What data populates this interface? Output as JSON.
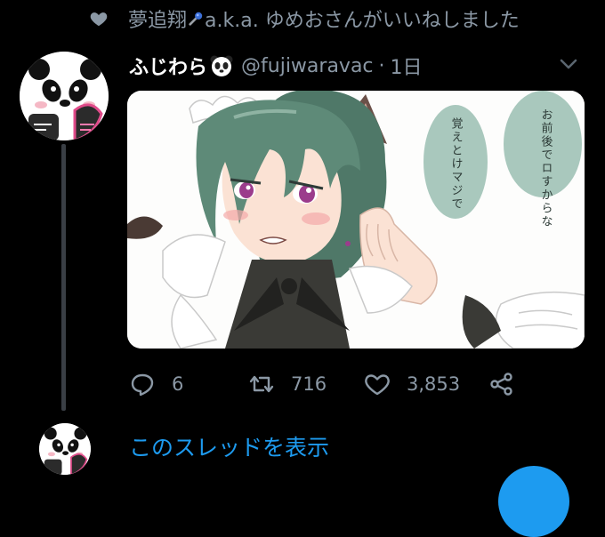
{
  "social_context": {
    "name_before_icon": "夢追翔",
    "name_after_icon": "a.k.a. ゆめおさんがいいねしました"
  },
  "tweet": {
    "display_name": "ふじわら",
    "handle": "@fujiwaravac",
    "separator": "·",
    "time": "1日",
    "media": {
      "bubble_right": "お前後でロすからな",
      "bubble_left": "覚えとけマジで"
    },
    "actions": {
      "reply_count": "6",
      "retweet_count": "716",
      "like_count": "3,853"
    }
  },
  "show_thread_label": "このスレッドを表示",
  "colors": {
    "background": "#000000",
    "secondary_text": "#8b98a5",
    "link_blue": "#1d9bf0",
    "thread_line": "#3a3f45"
  },
  "icons": [
    "heart-icon",
    "microphone-icon",
    "panda-emoji-icon",
    "chevron-down-icon",
    "reply-icon",
    "retweet-icon",
    "like-icon",
    "share-icon"
  ]
}
